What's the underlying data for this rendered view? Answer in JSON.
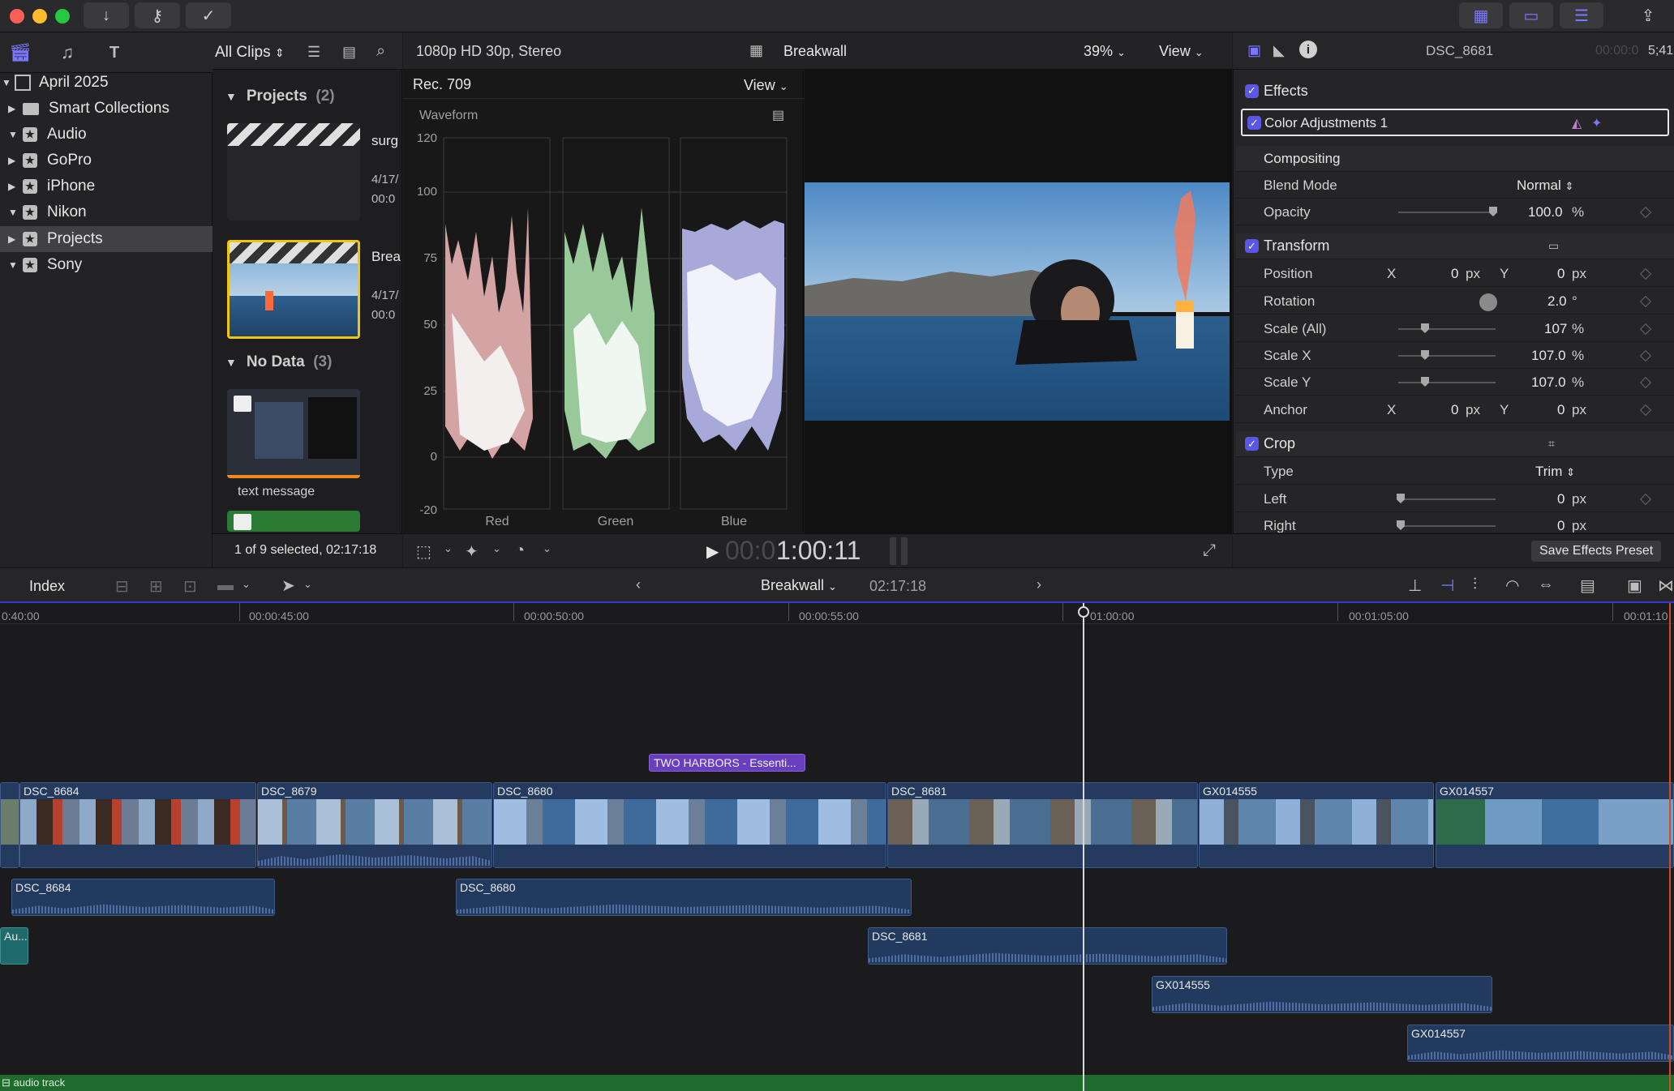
{
  "titlebar": {
    "buttons": [
      "download-icon",
      "key-icon",
      "checkmark-icon"
    ],
    "right_buttons": [
      "grid-icon",
      "filmstrip-icon",
      "sliders-icon",
      "share-icon"
    ]
  },
  "browser": {
    "clip_filter": "All Clips",
    "libraries": [
      {
        "label": "April 2025",
        "expanded": true,
        "type": "library"
      },
      {
        "label": "Smart Collections",
        "type": "folder"
      },
      {
        "label": "Audio",
        "type": "event"
      },
      {
        "label": "GoPro",
        "type": "event"
      },
      {
        "label": "iPhone",
        "type": "event"
      },
      {
        "label": "Nikon",
        "type": "event"
      },
      {
        "label": "Projects",
        "type": "event",
        "selected": true
      },
      {
        "label": "Sony",
        "type": "event"
      }
    ],
    "groups": [
      {
        "label": "Projects",
        "count": "(2)"
      },
      {
        "label": "No Data",
        "count": "(3)"
      }
    ],
    "clips": [
      {
        "name": "surg",
        "date": "4/17/",
        "time": "00:0"
      },
      {
        "name": "Brea",
        "date": "4/17/",
        "time": "00:0"
      },
      {
        "name": "text message"
      }
    ],
    "status": "1 of 9 selected, 02:17:18"
  },
  "viewer": {
    "format": "1080p HD 30p, Stereo",
    "project": "Breakwall",
    "zoom": "39%",
    "view_label": "View",
    "timecode_dim": "00:0",
    "timecode": "1:00:11"
  },
  "scopes": {
    "standard": "Rec. 709",
    "view_label": "View",
    "title": "Waveform",
    "yticks": [
      "120",
      "100",
      "75",
      "50",
      "25",
      "0",
      "-20"
    ],
    "channels": [
      "Red",
      "Green",
      "Blue"
    ]
  },
  "inspector": {
    "clip_name": "DSC_8681",
    "timecode_dim": "00:00:0",
    "timecode": "5;41",
    "sections": {
      "effects": "Effects",
      "color_adj": "Color Adjustments 1",
      "compositing": "Compositing",
      "transform": "Transform",
      "crop": "Crop"
    },
    "rows": {
      "blend_mode": {
        "label": "Blend Mode",
        "value": "Normal"
      },
      "opacity": {
        "label": "Opacity",
        "value": "100.0",
        "unit": "%"
      },
      "position": {
        "label": "Position",
        "x_label": "X",
        "x": "0",
        "x_unit": "px",
        "y_label": "Y",
        "y": "0",
        "y_unit": "px"
      },
      "rotation": {
        "label": "Rotation",
        "value": "2.0",
        "unit": "°"
      },
      "scale_all": {
        "label": "Scale (All)",
        "value": "107",
        "unit": "%"
      },
      "scale_x": {
        "label": "Scale X",
        "value": "107.0",
        "unit": "%"
      },
      "scale_y": {
        "label": "Scale Y",
        "value": "107.0",
        "unit": "%"
      },
      "anchor": {
        "label": "Anchor",
        "x_label": "X",
        "x": "0",
        "x_unit": "px",
        "y_label": "Y",
        "y": "0",
        "y_unit": "px"
      },
      "type": {
        "label": "Type",
        "value": "Trim"
      },
      "left": {
        "label": "Left",
        "value": "0",
        "unit": "px"
      },
      "right": {
        "label": "Right",
        "value": "0",
        "unit": "px"
      }
    },
    "save_preset": "Save Effects Preset"
  },
  "timeline": {
    "index_label": "Index",
    "project": "Breakwall",
    "duration": "02:17:18",
    "ruler": [
      "0:40:00",
      "00:00:45:00",
      "00:00:50:00",
      "00:00:55:00",
      "01:00:00",
      "00:01:05:00",
      "00:01:10"
    ],
    "title_clip": "TWO HARBORS - Essenti...",
    "video_clips": [
      "DSC_8684",
      "DSC_8679",
      "DSC_8680",
      "DSC_8681",
      "GX014555",
      "GX014557"
    ],
    "audio_clips": [
      "DSC_8684",
      "DSC_8680",
      "Au...",
      "DSC_8681",
      "GX014555",
      "GX014557"
    ],
    "audio_track": "audio track"
  },
  "colors": {
    "accent": "#5a56e6",
    "selection": "#f2c50f",
    "clip_blue": "#243a5e",
    "title_purple": "#6a3fbf",
    "audio_green": "#1f6b2e"
  }
}
